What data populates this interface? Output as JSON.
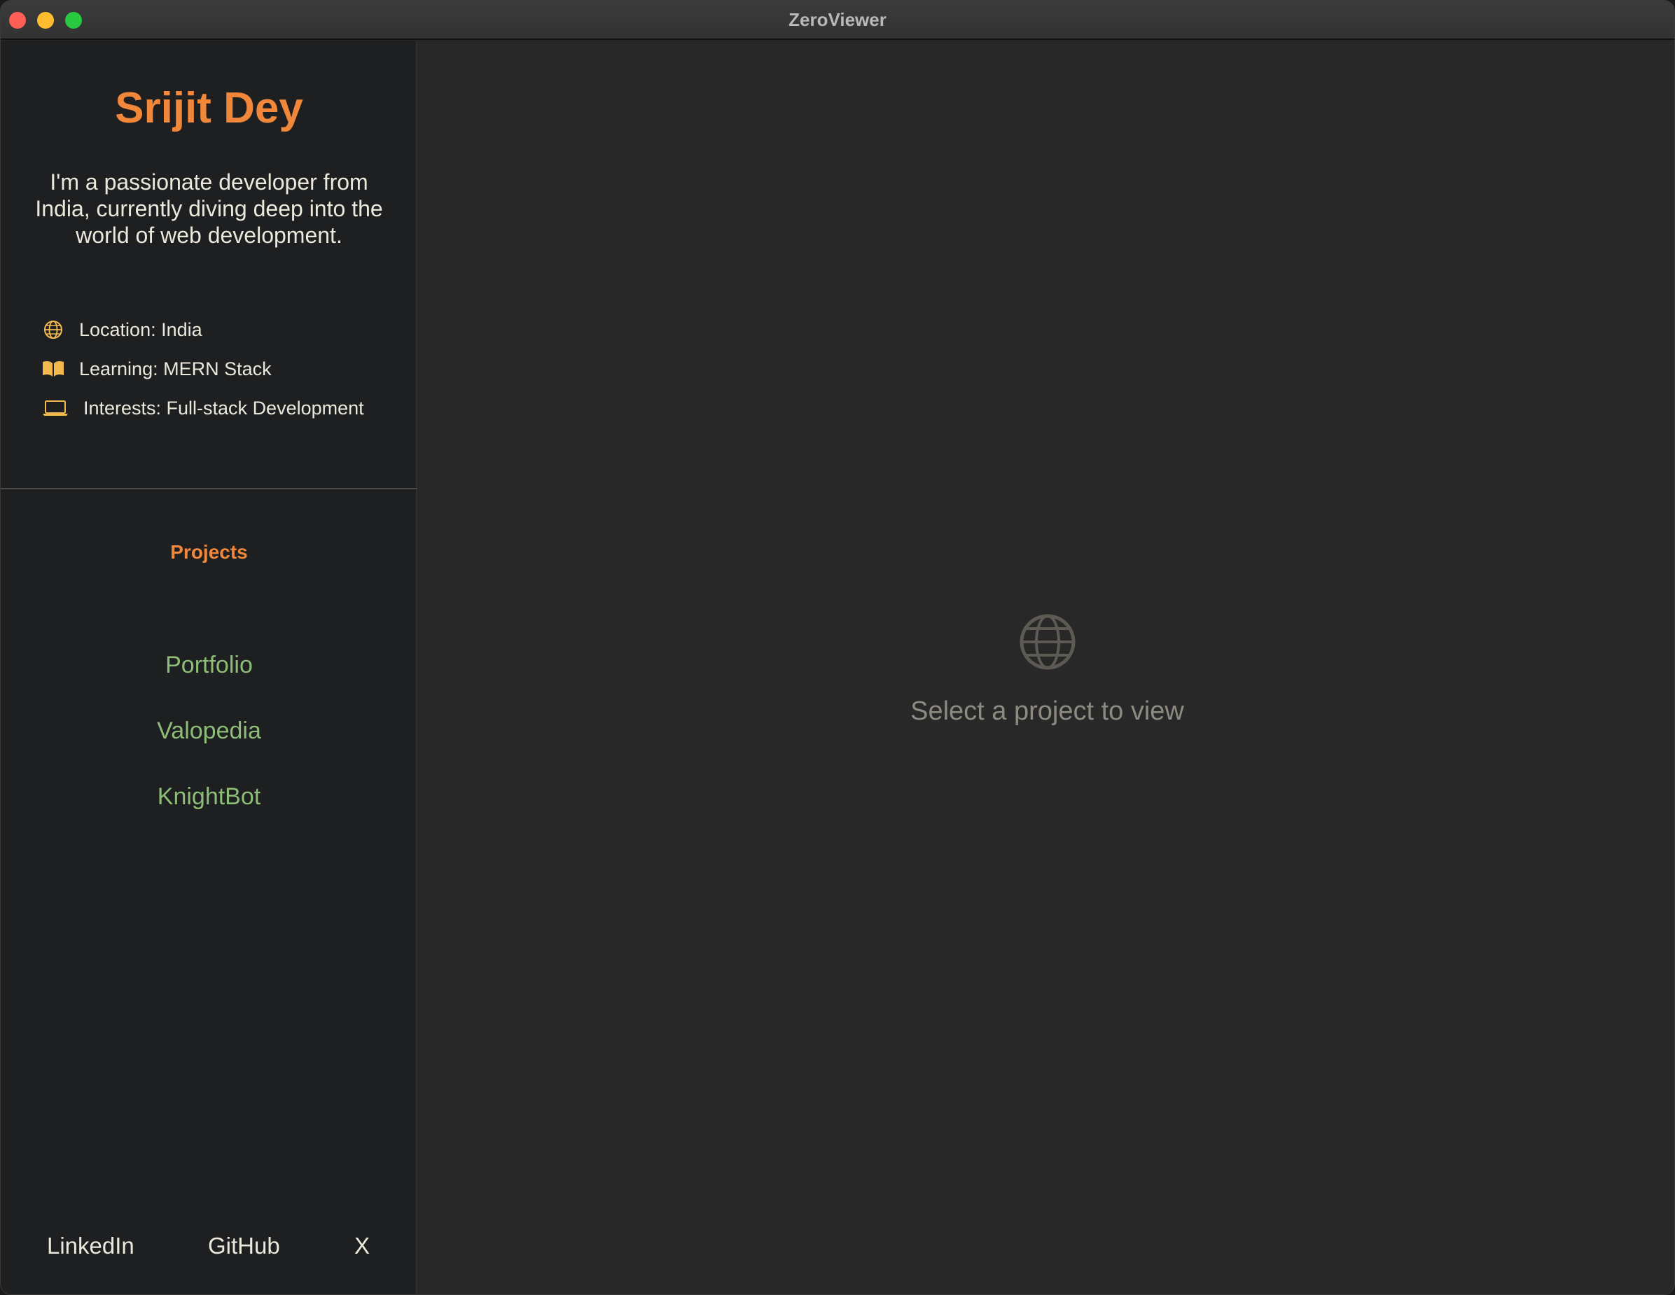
{
  "window": {
    "title": "ZeroViewer"
  },
  "profile": {
    "name": "Srijit Dey",
    "bio": "I'm a passionate developer from India, currently diving deep into the world of web development.",
    "info": [
      {
        "icon": "globe-icon",
        "text": "Location: India"
      },
      {
        "icon": "book-icon",
        "text": "Learning: MERN Stack"
      },
      {
        "icon": "laptop-icon",
        "text": "Interests: Full-stack Development"
      }
    ]
  },
  "projects": {
    "heading": "Projects",
    "items": [
      "Portfolio",
      "Valopedia",
      "KnightBot"
    ]
  },
  "socials": {
    "linkedin": "LinkedIn",
    "github": "GitHub",
    "x": "X"
  },
  "main": {
    "empty_icon": "globe-icon",
    "empty_text": "Select a project to view"
  },
  "colors": {
    "accent": "#f0873a",
    "project_link": "#8dbd76",
    "text": "#ece8dc",
    "muted": "#8d8a82",
    "icon": "#f3b94f"
  }
}
